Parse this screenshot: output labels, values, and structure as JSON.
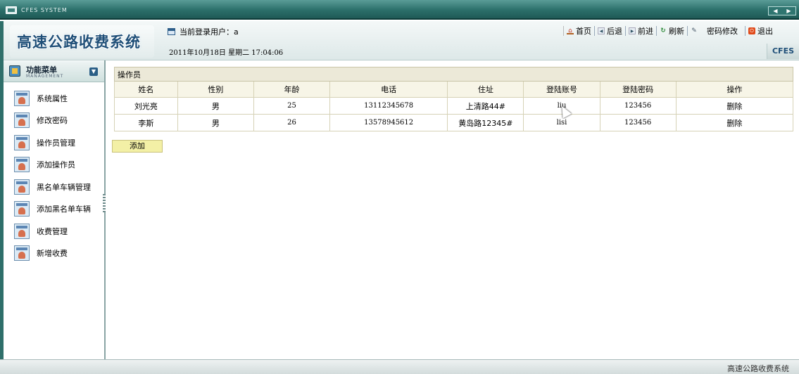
{
  "window": {
    "title": "CFES SYSTEM"
  },
  "header": {
    "brand": "高速公路收费系统",
    "current_user_label": "当前登录用户：a",
    "datetime": "2011年10月18日  星期二  17:04:06",
    "cfes_tag": "CFES",
    "toolbar": [
      {
        "label": "首页",
        "icon": "home-icon"
      },
      {
        "label": "后退",
        "icon": "back-icon"
      },
      {
        "label": "前进",
        "icon": "forward-icon"
      },
      {
        "label": "刷新",
        "icon": "refresh-icon"
      },
      {
        "label": "密码修改",
        "icon": "password-icon"
      },
      {
        "label": "退出",
        "icon": "exit-icon"
      }
    ]
  },
  "sidebar": {
    "title": "功能菜单",
    "subtitle": "MANAGEMENT",
    "items": [
      {
        "label": "系统属性"
      },
      {
        "label": "修改密码"
      },
      {
        "label": "操作员管理"
      },
      {
        "label": "添加操作员"
      },
      {
        "label": "黑名单车辆管理"
      },
      {
        "label": "添加黑名单车辆"
      },
      {
        "label": "收费管理"
      },
      {
        "label": "新增收费"
      }
    ]
  },
  "main": {
    "table_caption": "操作员",
    "columns": [
      "姓名",
      "性别",
      "年龄",
      "电话",
      "住址",
      "登陆账号",
      "登陆密码",
      "操作"
    ],
    "rows": [
      [
        "刘光亮",
        "男",
        "25",
        "13112345678",
        "上清路44#",
        "liu",
        "123456",
        "删除"
      ],
      [
        "李斯",
        "男",
        "26",
        "13578945612",
        "黄岛路12345#",
        "lisi",
        "123456",
        "删除"
      ]
    ],
    "add_button": "添加"
  },
  "statusbar": {
    "text": "高速公路收费系统"
  }
}
